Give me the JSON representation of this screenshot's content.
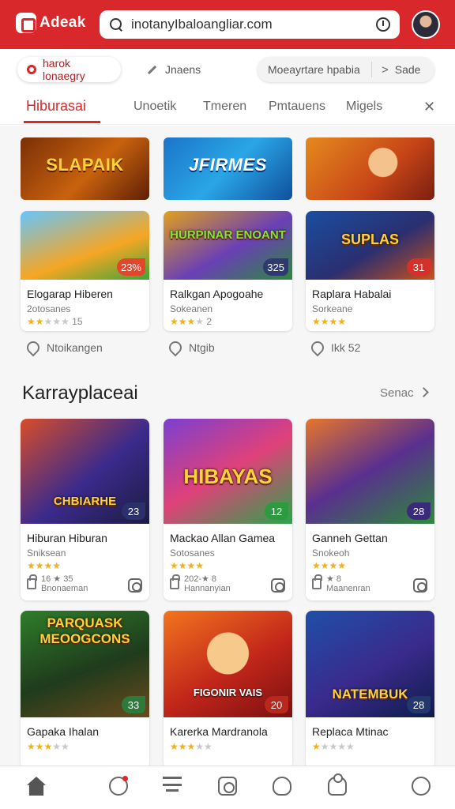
{
  "header": {
    "logo_text": "Adeak",
    "search_value": "inotanyIbaloangliar.com",
    "brand_color": "#d8282b"
  },
  "filters": {
    "location_chip": "harok lonaegry",
    "edit_chip": "Jnaens",
    "group_left": "Moeayrtare hpabia",
    "group_right": "Sade"
  },
  "tabs": [
    "Hiburasai",
    "Unoetik",
    "Tmeren",
    "Pmtauens",
    "Migels"
  ],
  "banners": [
    "SLAPAIK",
    "JFIRMES",
    ""
  ],
  "top_games": [
    {
      "art": "",
      "badge": "23%",
      "title": "Elogarap Hiberen",
      "subtitle": "2otosanes",
      "stars": 2,
      "rating": "15",
      "badge_color": "#e2462b"
    },
    {
      "art": "HURPINAR ENOANT",
      "badge": "325",
      "title": "Ralkgan Apogoahe",
      "subtitle": "Sokeanen",
      "stars": 3,
      "rating": "2",
      "badge_color": "#2e3a6e"
    },
    {
      "art": "SUPLAS",
      "badge": "31",
      "title": "Raplara Habalai",
      "subtitle": "Sorkeane",
      "stars": 4,
      "rating": "",
      "badge_color": "#d6302a"
    }
  ],
  "likes": [
    "Ntoikangen",
    "Ntgib",
    "Ikk 52"
  ],
  "section": {
    "title": "Karrayplaceai",
    "more": "Senac"
  },
  "games": [
    {
      "art": "CHBIARHE",
      "badge": "23",
      "title": "Hiburan Hiburan",
      "subtitle": "Sniksean",
      "stars": 4,
      "meta1": "16 ★ 35",
      "meta2": "Bnonaeman",
      "badge_color": "#2b2f6a"
    },
    {
      "art": "HIBAYAS",
      "badge": "12",
      "title": "Mackao Allan Gamea",
      "subtitle": "Sotosanes",
      "stars": 4,
      "meta1": "202-★ 8",
      "meta2": "Hannanyian",
      "badge_color": "#2c9a3e"
    },
    {
      "art": "",
      "badge": "28",
      "title": "Ganneh Gettan",
      "subtitle": "Snokeoh",
      "stars": 4,
      "meta1": "★ 8",
      "meta2": "Maanenran",
      "badge_color": "#3a2a7a"
    },
    {
      "art": "PARQUASK MEOOGCONS",
      "badge": "33",
      "title": "Gapaka Ihalan",
      "subtitle": "",
      "stars": 3,
      "rating": "",
      "badge_color": "#2e7a3a"
    },
    {
      "art": "FIGONIR VAIS",
      "badge": "20",
      "title": "Karerka Mardranola",
      "subtitle": "",
      "stars": 3,
      "rating": "",
      "badge_color": "#b8281c"
    },
    {
      "art": "NATEMBUK",
      "badge": "28",
      "title": "Replaca Mtinac",
      "subtitle": "",
      "stars": 1,
      "rating": "",
      "badge_color": "#23366e"
    }
  ],
  "nav": [
    "home-icon",
    "alert-icon",
    "list-icon",
    "camera-icon",
    "heart-icon",
    "profile-icon",
    "settings-icon"
  ]
}
